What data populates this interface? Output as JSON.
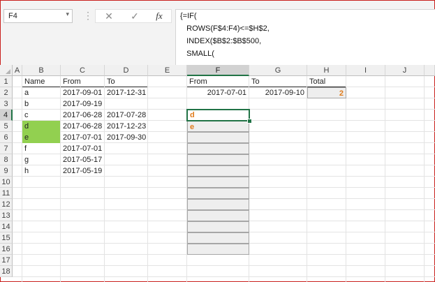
{
  "name_box": {
    "value": "F4",
    "dropdown_icon": "chevron-down-icon"
  },
  "formula_bar": {
    "cancel_icon": "cancel-icon",
    "enter_icon": "enter-checkmark-icon",
    "fx_label": "fx",
    "lines": [
      "{=IF(",
      "   ROWS(F$4:F4)<=$H$2,",
      "   INDEX($B$2:$B$500,",
      "   SMALL("
    ]
  },
  "columns": [
    "A",
    "B",
    "C",
    "D",
    "E",
    "F",
    "G",
    "H",
    "I",
    "J"
  ],
  "rows": [
    "1",
    "2",
    "3",
    "4",
    "5",
    "6",
    "7",
    "8",
    "9",
    "10",
    "11",
    "12",
    "13",
    "14",
    "15",
    "16",
    "17",
    "18"
  ],
  "selected_cell": {
    "column": "F",
    "row": "4"
  },
  "table": {
    "headers": {
      "name": "Name",
      "from": "From",
      "to": "To"
    },
    "records": [
      {
        "name": "a",
        "from": "2017-09-01",
        "to": "2017-12-31",
        "highlight": false
      },
      {
        "name": "b",
        "from": "2017-09-19",
        "to": "",
        "highlight": false
      },
      {
        "name": "c",
        "from": "2017-06-28",
        "to": "2017-07-28",
        "highlight": false
      },
      {
        "name": "d",
        "from": "2017-06-28",
        "to": "2017-12-23",
        "highlight": true
      },
      {
        "name": "e",
        "from": "2017-07-01",
        "to": "2017-09-30",
        "highlight": true
      },
      {
        "name": "f",
        "from": "2017-07-01",
        "to": "",
        "highlight": false
      },
      {
        "name": "g",
        "from": "2017-05-17",
        "to": "",
        "highlight": false
      },
      {
        "name": "h",
        "from": "2017-05-19",
        "to": "",
        "highlight": false
      }
    ]
  },
  "criteria": {
    "headers": {
      "from": "From",
      "to": "To",
      "total": "Total"
    },
    "from_value": "2017-07-01",
    "to_value": "2017-09-10",
    "total_value": "2"
  },
  "results": [
    "d",
    "e",
    "",
    "",
    "",
    "",
    "",
    "",
    "",
    "",
    "",
    "",
    ""
  ],
  "colors": {
    "highlight_green": "#92d050",
    "result_orange": "#e07b1b",
    "selection_green": "#217346",
    "frame_red": "#c9201d"
  }
}
